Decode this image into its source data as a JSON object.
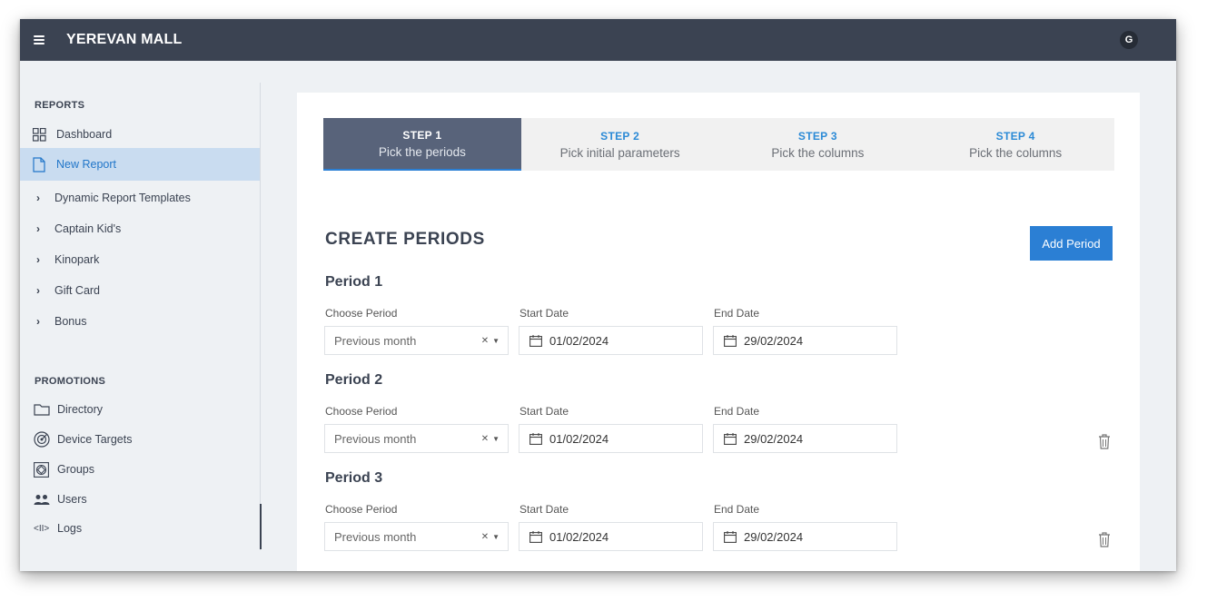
{
  "app": {
    "title": "YEREVAN MALL",
    "user_initial": "G",
    "menu_icon": "hamburger-menu-icon"
  },
  "sidebar": {
    "reports_title": "REPORTS",
    "reports": [
      {
        "label": "Dashboard",
        "icon": "dashboard-grid-icon"
      },
      {
        "label": "New Report",
        "icon": "document-icon",
        "active": true
      }
    ],
    "groups": [
      {
        "label": "Dynamic Report Templates"
      },
      {
        "label": "Captain Kid's"
      },
      {
        "label": "Kinopark"
      },
      {
        "label": "Gift Card"
      },
      {
        "label": "Bonus"
      }
    ],
    "promotions_title": "PROMOTIONS",
    "promotions": [
      {
        "label": "Directory",
        "icon": "folder-icon"
      },
      {
        "label": "Device Targets",
        "icon": "target-icon"
      },
      {
        "label": "Groups",
        "icon": "groups-icon"
      },
      {
        "label": "Users",
        "icon": "users-icon"
      },
      {
        "label": "Logs",
        "icon": "code-icon",
        "glyph": "<II>"
      }
    ]
  },
  "steps": [
    {
      "num": "STEP 1",
      "desc": "Pick the periods",
      "active": true
    },
    {
      "num": "STEP 2",
      "desc": "Pick initial parameters"
    },
    {
      "num": "STEP 3",
      "desc": "Pick the columns"
    },
    {
      "num": "STEP 4",
      "desc": "Pick the columns"
    }
  ],
  "main": {
    "title": "CREATE PERIODS",
    "add_button": "Add Period",
    "periods": [
      {
        "title": "Period 1",
        "choose_label": "Choose Period",
        "choose_value": "Previous month",
        "start_label": "Start Date",
        "start_value": "01/02/2024",
        "end_label": "End Date",
        "end_value": "29/02/2024",
        "deletable": false
      },
      {
        "title": "Period 2",
        "choose_label": "Choose Period",
        "choose_value": "Previous month",
        "start_label": "Start Date",
        "start_value": "01/02/2024",
        "end_label": "End Date",
        "end_value": "29/02/2024",
        "deletable": true
      },
      {
        "title": "Period 3",
        "choose_label": "Choose Period",
        "choose_value": "Previous month",
        "start_label": "Start Date",
        "start_value": "01/02/2024",
        "end_label": "End Date",
        "end_value": "29/02/2024",
        "deletable": true
      }
    ]
  },
  "colors": {
    "topbar": "#3b4352",
    "accent": "#2b7fd4",
    "active_step": "#58637a",
    "active_nav": "#c9dcf0"
  }
}
